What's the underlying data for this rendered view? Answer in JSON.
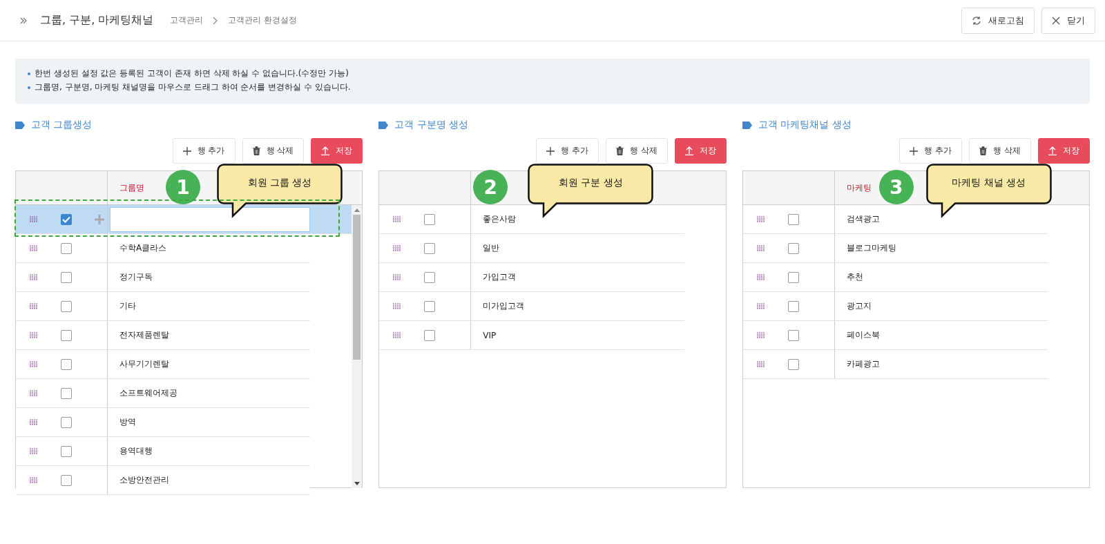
{
  "header": {
    "title": "그룹, 구분, 마케팅채널",
    "breadcrumb": [
      "고객관리",
      "고객관리 환경설정"
    ],
    "buttons": [
      {
        "kind": "refresh",
        "label": "새로고침"
      },
      {
        "kind": "close",
        "label": "닫기"
      }
    ]
  },
  "notice": [
    "한번 생성된 설정 값은 등록된 고객이 존재 하면 삭제 하실 수 없습니다.(수정만 가능)",
    "그룹명, 구분명, 마케팅 채널명을 마우스로 드래그 하여 순서를 변경하실 수 있습니다."
  ],
  "panels": [
    {
      "title": "고객 그룹생성",
      "buttons": [
        {
          "kind": "add",
          "label": "행 추가"
        },
        {
          "kind": "delete",
          "label": "행 삭제"
        },
        {
          "kind": "save",
          "label": "저장"
        }
      ],
      "column": "그룹명",
      "badge": "1",
      "callout": "회원 그룹 생성",
      "rows": [
        {
          "kind": "input",
          "checked": true,
          "selected": true
        },
        {
          "kind": "text",
          "name": "수학A클라스",
          "checked": false,
          "selected": false
        },
        {
          "kind": "text",
          "name": "정기구독",
          "checked": false,
          "selected": false
        },
        {
          "kind": "text",
          "name": "기타",
          "checked": false,
          "selected": false
        },
        {
          "kind": "text",
          "name": "전자제품렌탈",
          "checked": false,
          "selected": false
        },
        {
          "kind": "text",
          "name": "사무기기렌탈",
          "checked": false,
          "selected": false
        },
        {
          "kind": "text",
          "name": "소프트웨어제공",
          "checked": false,
          "selected": false
        },
        {
          "kind": "text",
          "name": "방역",
          "checked": false,
          "selected": false
        },
        {
          "kind": "text",
          "name": "용역대행",
          "checked": false,
          "selected": false
        },
        {
          "kind": "text",
          "name": "소방안전관리",
          "checked": false,
          "selected": false
        }
      ]
    },
    {
      "title": "고객 구분명 생성",
      "buttons": [
        {
          "kind": "add",
          "label": "행 추가"
        },
        {
          "kind": "delete",
          "label": "행 삭제"
        },
        {
          "kind": "save",
          "label": "저장"
        }
      ],
      "badge": "2",
      "callout": "회원 구분 생성",
      "rows": [
        {
          "kind": "text",
          "name": "좋은사람",
          "checked": false,
          "selected": false
        },
        {
          "kind": "text",
          "name": "일반",
          "checked": false,
          "selected": false
        },
        {
          "kind": "text",
          "name": "가입고객",
          "checked": false,
          "selected": false
        },
        {
          "kind": "text",
          "name": "미가입고객",
          "checked": false,
          "selected": false
        },
        {
          "kind": "text",
          "name": "VIP",
          "checked": false,
          "selected": false
        }
      ]
    },
    {
      "title": "고객 마케팅채널 생성",
      "buttons": [
        {
          "kind": "add",
          "label": "행 추가"
        },
        {
          "kind": "delete",
          "label": "행 삭제"
        },
        {
          "kind": "save",
          "label": "저장"
        }
      ],
      "column": "마케팅",
      "badge": "3",
      "callout": "마케팅 채널 생성",
      "rows": [
        {
          "kind": "text",
          "name": "검색광고",
          "checked": false,
          "selected": false
        },
        {
          "kind": "text",
          "name": "블로그마케팅",
          "checked": false,
          "selected": false
        },
        {
          "kind": "text",
          "name": "추천",
          "checked": false,
          "selected": false
        },
        {
          "kind": "text",
          "name": "광고지",
          "checked": false,
          "selected": false
        },
        {
          "kind": "text",
          "name": "페이스북",
          "checked": false,
          "selected": false
        },
        {
          "kind": "text",
          "name": "카페광고",
          "checked": false,
          "selected": false
        }
      ]
    }
  ]
}
